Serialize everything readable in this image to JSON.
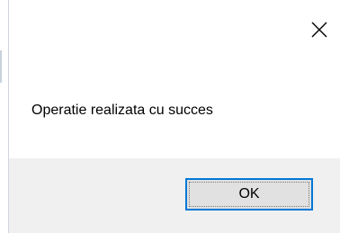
{
  "dialog": {
    "message": "Operatie realizata cu succes",
    "ok_label": "OK",
    "close_icon": "close-icon"
  },
  "colors": {
    "accent": "#0078d7",
    "footer_bg": "#f0f0f0",
    "button_bg": "#e1e1e1"
  }
}
